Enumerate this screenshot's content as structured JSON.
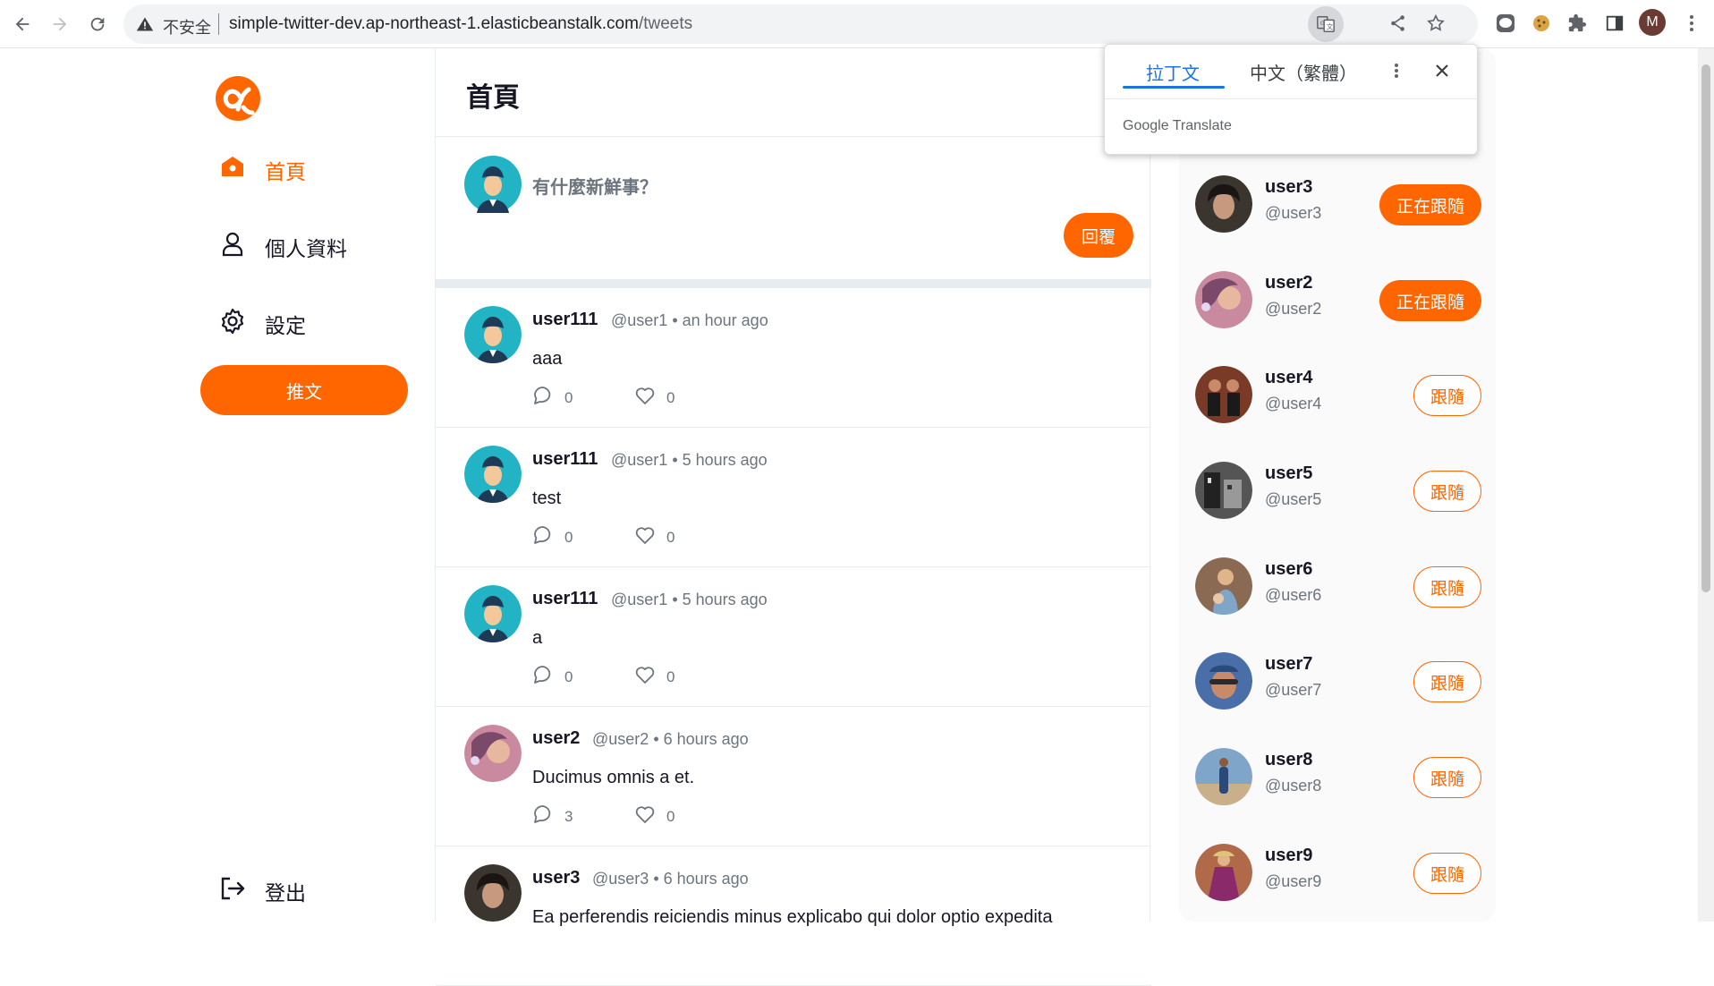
{
  "browser": {
    "security_label": "不安全",
    "url_host": "simple-twitter-dev.ap-northeast-1.elasticbeanstalk.com",
    "url_path": "/tweets",
    "profile_initial": "M"
  },
  "translate_popup": {
    "tabs": [
      "拉丁文",
      "中文（繁體）"
    ],
    "active_tab": "拉丁文",
    "brand": "Google Translate"
  },
  "sidebar": {
    "items": [
      {
        "label": "首頁",
        "icon": "home-icon",
        "active": true
      },
      {
        "label": "個人資料",
        "icon": "user-icon",
        "active": false
      },
      {
        "label": "設定",
        "icon": "gear-icon",
        "active": false
      }
    ],
    "tweet_button": "推文",
    "logout": "登出"
  },
  "main": {
    "title": "首頁",
    "compose_placeholder": "有什麼新鮮事？",
    "compose_button": "回覆",
    "tweets": [
      {
        "name": "user111",
        "handle": "@user1",
        "time": "an hour ago",
        "text": "aaa",
        "replies": "0",
        "likes": "0",
        "avatar": "default-avatar"
      },
      {
        "name": "user111",
        "handle": "@user1",
        "time": "5 hours ago",
        "text": "test",
        "replies": "0",
        "likes": "0",
        "avatar": "default-avatar"
      },
      {
        "name": "user111",
        "handle": "@user1",
        "time": "5 hours ago",
        "text": "a",
        "replies": "0",
        "likes": "0",
        "avatar": "default-avatar"
      },
      {
        "name": "user2",
        "handle": "@user2",
        "time": "6 hours ago",
        "text": "Ducimus omnis a et.",
        "replies": "3",
        "likes": "0",
        "avatar": "photo-avatar"
      },
      {
        "name": "user3",
        "handle": "@user3",
        "time": "6 hours ago",
        "text": "Ea perferendis reiciendis minus explicabo qui dolor optio expedita",
        "replies": "",
        "likes": "",
        "avatar": "photo-avatar"
      }
    ]
  },
  "recommend": {
    "following_label": "正在跟隨",
    "follow_label": "跟隨",
    "users": [
      {
        "name": "user3",
        "handle": "@user3",
        "following": true,
        "color": "#3b3530"
      },
      {
        "name": "user2",
        "handle": "@user2",
        "following": true,
        "color": "#c98aa0"
      },
      {
        "name": "user4",
        "handle": "@user4",
        "following": false,
        "color": "#7a3a28"
      },
      {
        "name": "user5",
        "handle": "@user5",
        "following": false,
        "color": "#555555"
      },
      {
        "name": "user6",
        "handle": "@user6",
        "following": false,
        "color": "#8a6a52"
      },
      {
        "name": "user7",
        "handle": "@user7",
        "following": false,
        "color": "#4a6fa8"
      },
      {
        "name": "user8",
        "handle": "@user8",
        "following": false,
        "color": "#7fa6c9"
      },
      {
        "name": "user9",
        "handle": "@user9",
        "following": false,
        "color": "#b06a4a"
      }
    ]
  },
  "colors": {
    "accent": "#ff6600",
    "default_avatar_bg": "#22b3c4"
  }
}
